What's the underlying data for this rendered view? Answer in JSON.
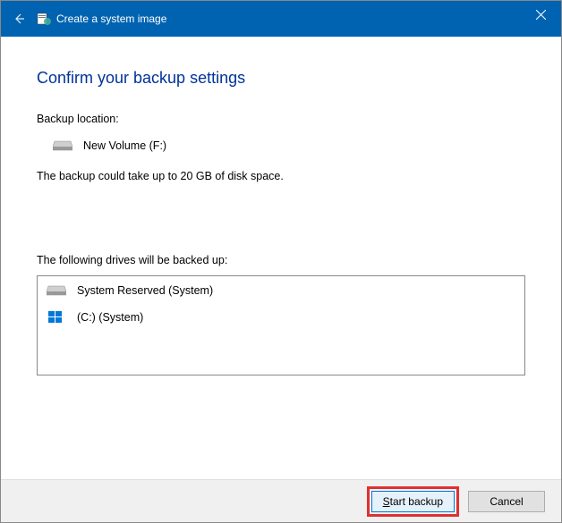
{
  "window": {
    "title": "Create a system image"
  },
  "page": {
    "heading": "Confirm your backup settings",
    "backup_location_label": "Backup location:",
    "backup_location_value": "New Volume (F:)",
    "size_estimate": "The backup could take up to 20 GB of disk space.",
    "drives_label": "The following drives will be backed up:",
    "drives": [
      {
        "name": "System Reserved (System)",
        "icon": "hard-drive"
      },
      {
        "name": "(C:) (System)",
        "icon": "windows"
      }
    ]
  },
  "buttons": {
    "start_backup": "Start backup",
    "cancel": "Cancel"
  }
}
